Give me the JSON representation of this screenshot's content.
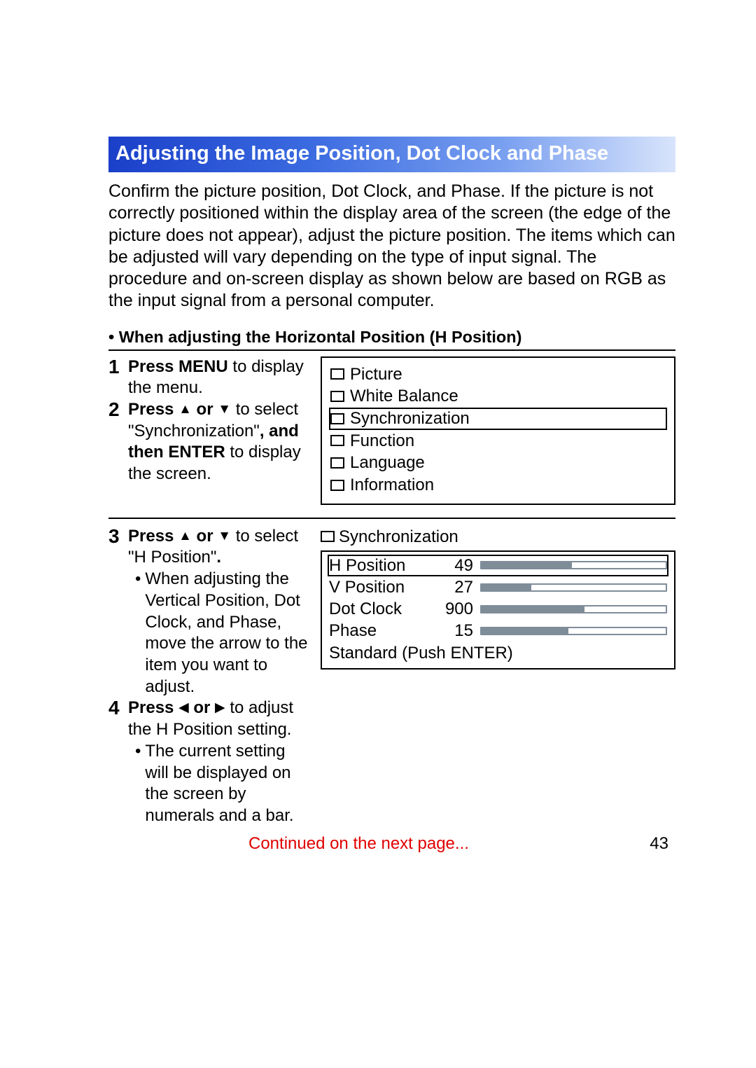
{
  "title": "Adjusting the Image Position, Dot Clock and Phase",
  "intro": "Confirm the picture position, Dot Clock, and Phase. If the picture is not correctly positioned within the display area of the screen (the edge of the picture does not appear), adjust the picture position. The items which can be adjusted will vary depending on the type of input signal.\nThe procedure and on-screen display as shown below are based on RGB as the input signal from a personal computer.",
  "subheading": "• When adjusting the Horizontal Position (H Position)",
  "steps": {
    "s1": {
      "num": "1",
      "b1": "Press MENU",
      "t1": " to display the menu."
    },
    "s2": {
      "num": "2",
      "b1": "Press ",
      "b2": " or ",
      "t1": " to select \"Synchronization\"",
      "b3": ", and then ENTER",
      "t2": " to display the screen."
    },
    "s3": {
      "num": "3",
      "b1": "Press ",
      "b2": " or ",
      "t1": " to select \"H Position\"",
      "b3": ".",
      "bullet": "When adjusting the Vertical Position, Dot Clock, and Phase, move the arrow to the item you want to adjust."
    },
    "s4": {
      "num": "4",
      "b1": "Press ",
      "b2": " or ",
      "t1": " to adjust the H Position setting.",
      "bullet": "The current setting will be displayed on the screen by numerals and a bar."
    }
  },
  "menu": {
    "items": [
      {
        "label": "Picture",
        "selected": false
      },
      {
        "label": "White Balance",
        "selected": false
      },
      {
        "label": "Synchronization",
        "selected": true
      },
      {
        "label": "Function",
        "selected": false
      },
      {
        "label": "Language",
        "selected": false
      },
      {
        "label": "Information",
        "selected": false
      }
    ]
  },
  "sync": {
    "title": "Synchronization",
    "rows": [
      {
        "label": "H Position",
        "value": "49",
        "pct": 49,
        "selected": true
      },
      {
        "label": "V Position",
        "value": "27",
        "pct": 27,
        "selected": false
      },
      {
        "label": "Dot Clock",
        "value": "900",
        "pct": 56,
        "selected": false
      },
      {
        "label": "Phase",
        "value": "15",
        "pct": 47,
        "selected": false
      }
    ],
    "footer": "Standard (Push ENTER)"
  },
  "continued": "Continued on the next page...",
  "page": "43",
  "glyph": {
    "up": "▲",
    "down": "▼",
    "left": "◀",
    "right": "▶"
  }
}
